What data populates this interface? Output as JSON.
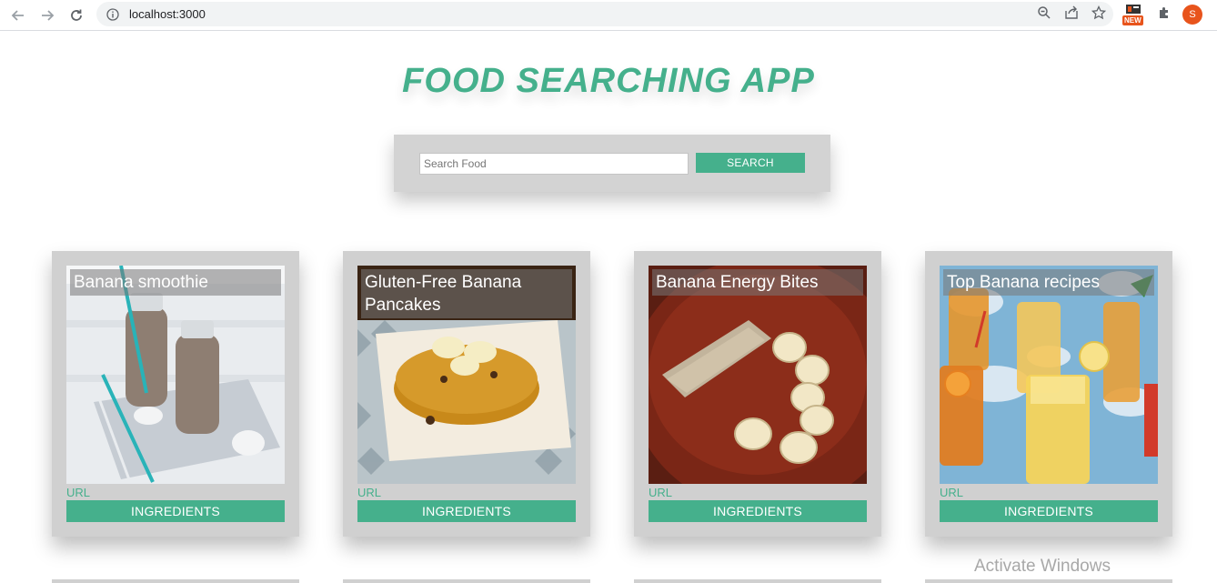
{
  "browser": {
    "url": "localhost:3000",
    "new_badge": "NEW",
    "avatar_initial": "S"
  },
  "app": {
    "title": "FOOD SEARCHING APP",
    "search": {
      "placeholder": "Search Food",
      "value": "",
      "button_label": "SEARCH"
    },
    "accent_color": "#45b08c",
    "cards": [
      {
        "title": "Banana smoothie",
        "url_label": "URL",
        "button_label": "INGREDIENTS"
      },
      {
        "title": "Gluten-Free Banana Pancakes",
        "url_label": "URL",
        "button_label": "INGREDIENTS"
      },
      {
        "title": "Banana Energy Bites",
        "url_label": "URL",
        "button_label": "INGREDIENTS"
      },
      {
        "title": "Top Banana recipes",
        "url_label": "URL",
        "button_label": "INGREDIENTS"
      }
    ]
  },
  "os_watermark": "Activate Windows"
}
